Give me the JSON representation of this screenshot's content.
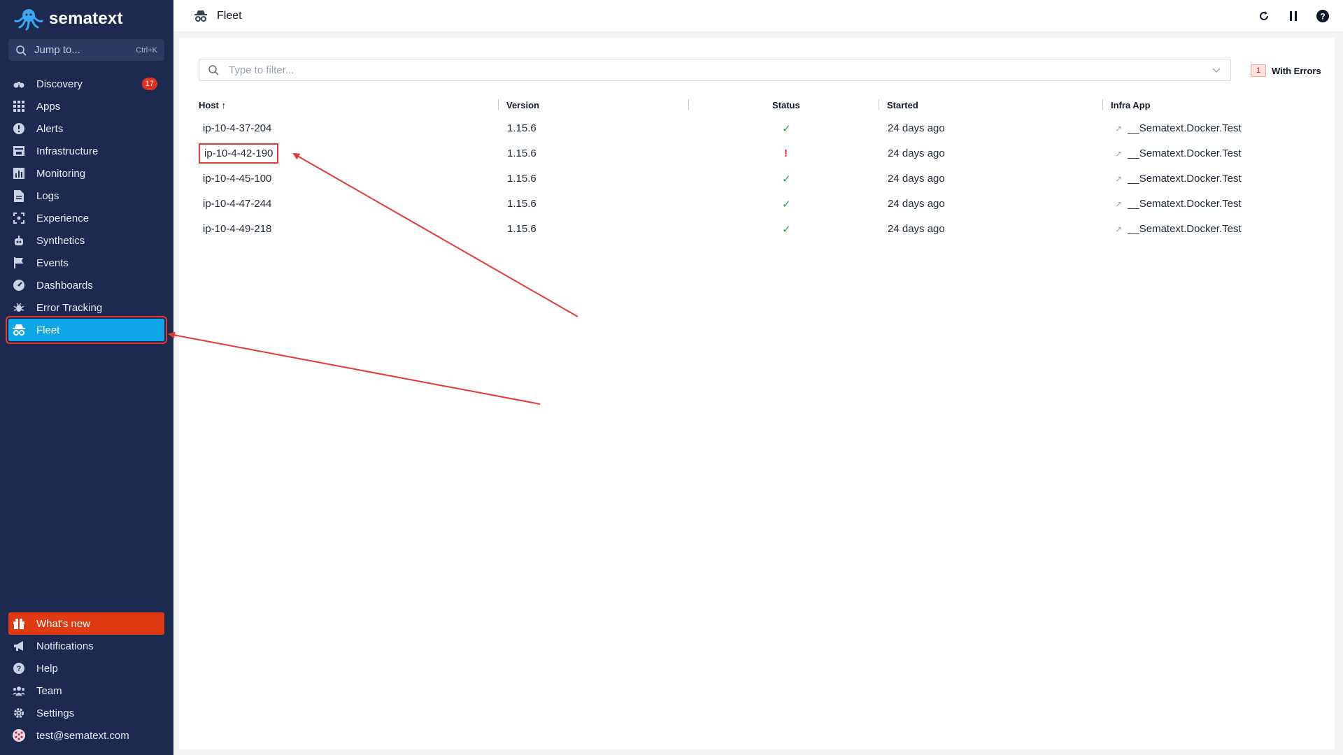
{
  "app": {
    "name": "sematext"
  },
  "search": {
    "placeholder": "Jump to...",
    "shortcut": "Ctrl+K"
  },
  "sidebar": {
    "items": [
      {
        "label": "Discovery",
        "icon": "binoculars-icon",
        "badge": "17"
      },
      {
        "label": "Apps",
        "icon": "grid-icon"
      },
      {
        "label": "Alerts",
        "icon": "alert-icon"
      },
      {
        "label": "Infrastructure",
        "icon": "server-icon"
      },
      {
        "label": "Monitoring",
        "icon": "bar-chart-icon"
      },
      {
        "label": "Logs",
        "icon": "document-icon"
      },
      {
        "label": "Experience",
        "icon": "face-scan-icon"
      },
      {
        "label": "Synthetics",
        "icon": "robot-icon"
      },
      {
        "label": "Events",
        "icon": "flag-icon"
      },
      {
        "label": "Dashboards",
        "icon": "gauge-icon"
      },
      {
        "label": "Error Tracking",
        "icon": "bug-icon"
      },
      {
        "label": "Fleet",
        "icon": "spy-icon",
        "active": true
      }
    ],
    "bottom": [
      {
        "label": "What's new",
        "icon": "gift-icon"
      },
      {
        "label": "Notifications",
        "icon": "megaphone-icon"
      },
      {
        "label": "Help",
        "icon": "help-icon"
      },
      {
        "label": "Team",
        "icon": "team-icon"
      },
      {
        "label": "Settings",
        "icon": "gear-icon"
      },
      {
        "label": "test@sematext.com",
        "icon": "avatar-icon"
      }
    ]
  },
  "header": {
    "title": "Fleet"
  },
  "filter": {
    "placeholder": "Type to filter...",
    "errors_count": "1",
    "errors_label": "With Errors"
  },
  "table": {
    "columns": [
      "Host ↑",
      "Version",
      "Status",
      "Started",
      "Infra App"
    ],
    "rows": [
      {
        "host": "ip-10-4-37-204",
        "version": "1.15.6",
        "status": "ok",
        "status_glyph": "✓",
        "started": "24 days ago",
        "app": "__Sematext.Docker.Test"
      },
      {
        "host": "ip-10-4-42-190",
        "version": "1.15.6",
        "status": "error",
        "status_glyph": "!",
        "started": "24 days ago",
        "app": "__Sematext.Docker.Test"
      },
      {
        "host": "ip-10-4-45-100",
        "version": "1.15.6",
        "status": "ok",
        "status_glyph": "✓",
        "started": "24 days ago",
        "app": "__Sematext.Docker.Test"
      },
      {
        "host": "ip-10-4-47-244",
        "version": "1.15.6",
        "status": "ok",
        "status_glyph": "✓",
        "started": "24 days ago",
        "app": "__Sematext.Docker.Test"
      },
      {
        "host": "ip-10-4-49-218",
        "version": "1.15.6",
        "status": "ok",
        "status_glyph": "✓",
        "started": "24 days ago",
        "app": "__Sematext.Docker.Test"
      }
    ]
  },
  "colors": {
    "sidebar_bg": "#1b2a4e",
    "active": "#0ea5e9",
    "whats_new": "#e03a12",
    "ok": "#16a34a",
    "error": "#dc2626",
    "annotation": "#e53935"
  }
}
